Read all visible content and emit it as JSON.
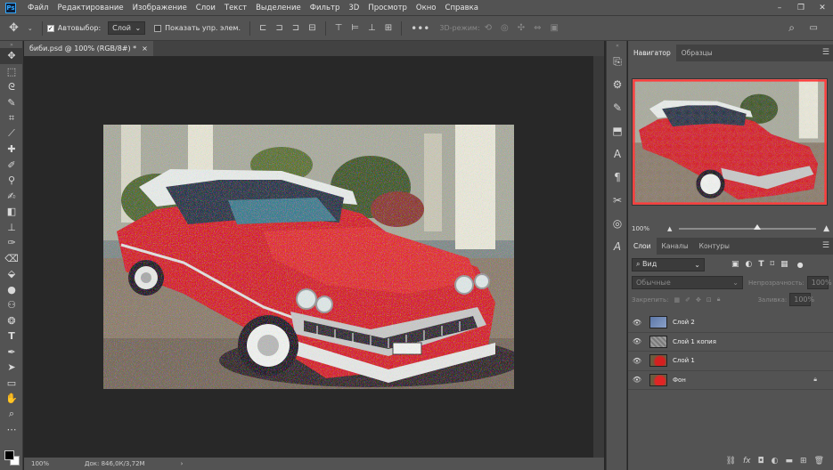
{
  "menu": [
    "Файл",
    "Редактирование",
    "Изображение",
    "Слои",
    "Текст",
    "Выделение",
    "Фильтр",
    "3D",
    "Просмотр",
    "Окно",
    "Справка"
  ],
  "app_logo": "Ps",
  "window_controls": {
    "minimize": "–",
    "restore": "❐",
    "close": "✕"
  },
  "options": {
    "autoselect_label": "Автовыбор:",
    "autoselect_value": "Слой",
    "show_transform_label": "Показать упр. элем.",
    "mode_3d_label": "3D-режим:"
  },
  "document": {
    "tab_title": "биби.psd @ 100% (RGB/8#) *",
    "tab_close": "×",
    "zoom": "100%",
    "doc_info": "Док: 846,0К/3,72М"
  },
  "navigator": {
    "tabs": [
      "Навигатор",
      "Образцы"
    ],
    "zoom": "100%"
  },
  "layers": {
    "tabs": [
      "Слои",
      "Каналы",
      "Контуры"
    ],
    "kind_filter": "Вид",
    "blend_mode": "Обычные",
    "opacity_label": "Непрозрачность:",
    "opacity_value": "100%",
    "lock_label": "Закрепить:",
    "fill_label": "Заливка:",
    "fill_value": "100%",
    "items": [
      {
        "name": "Слой 2"
      },
      {
        "name": "Слой 1 копия"
      },
      {
        "name": "Слой 1"
      },
      {
        "name": "Фон"
      }
    ]
  },
  "colors": {
    "accent": "#31a8ff",
    "ui_panel": "#535353",
    "canvas_bg": "#282828",
    "car_red": "#d42020",
    "nav_frame": "#ff3b3b"
  }
}
